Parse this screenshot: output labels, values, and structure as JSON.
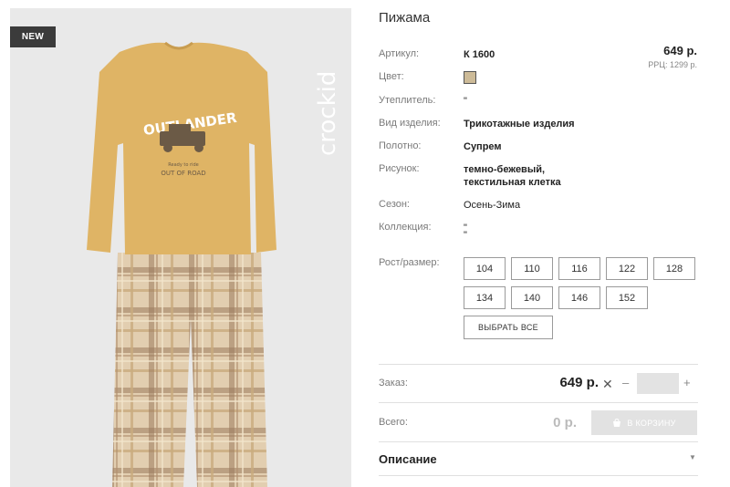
{
  "badge": "NEW",
  "brand": "crockid",
  "garment_print": {
    "headline": "OUTLANDER",
    "tagline": "Ready to ride",
    "footer": "OUT OF ROAD"
  },
  "product": {
    "title": "Пижама",
    "price": "649 р.",
    "rrp": "РРЦ: 1299 р.",
    "swatch_color": "#cdbb98",
    "attributes": [
      {
        "label": "Артикул:",
        "value": "К 1600"
      },
      {
        "label": "Цвет:",
        "value": ""
      },
      {
        "label": "Утеплитель:",
        "value": "\""
      },
      {
        "label": "Вид изделия:",
        "value": "Трикотажные изделия"
      },
      {
        "label": "Полотно:",
        "value": "Супрем"
      },
      {
        "label": "Рисунок:",
        "value": "темно-бежевый,",
        "value2": "текстильная клетка"
      },
      {
        "label": "Сезон:",
        "value": "Осень-Зима"
      },
      {
        "label": "Коллекция:",
        "value": "\"",
        "value2": "\""
      }
    ],
    "sizes_label": "Рост/размер:",
    "sizes": [
      "104",
      "110",
      "116",
      "122",
      "128",
      "134",
      "140",
      "146",
      "152"
    ],
    "select_all": "ВЫБРАТЬ ВСЕ"
  },
  "order": {
    "label": "Заказ:",
    "price": "649 р.",
    "times": "✕",
    "minus": "–",
    "plus": "+",
    "quantity": ""
  },
  "total": {
    "label": "Всего:",
    "value": "0 р.",
    "cart_button": "В КОРЗИНУ"
  },
  "description": {
    "title": "Описание",
    "chevron": "▼"
  }
}
